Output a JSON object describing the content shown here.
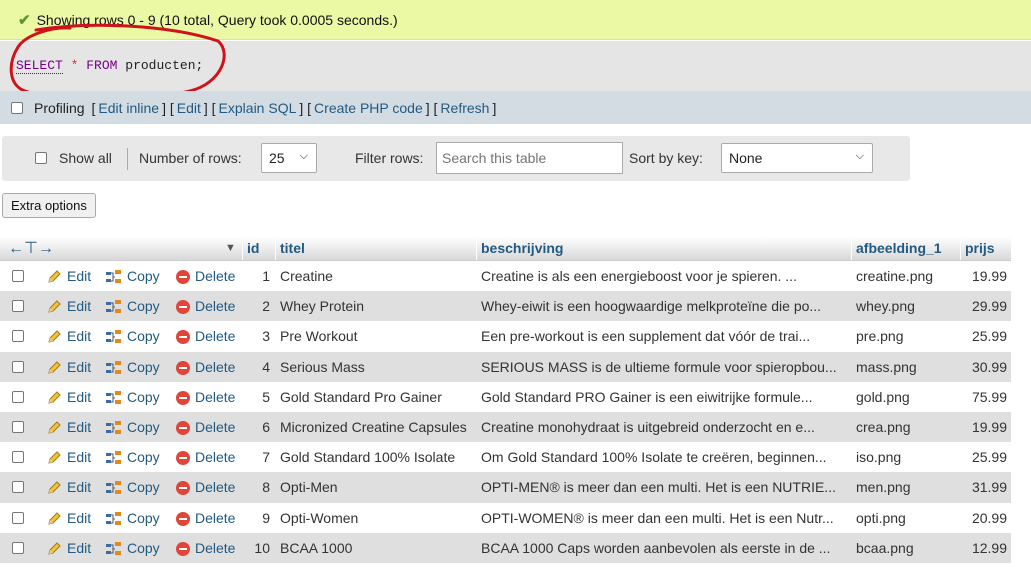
{
  "success": {
    "message": "Showing rows 0 - 9 (10 total, Query took 0.0005 seconds.)"
  },
  "sql": {
    "select": "SELECT",
    "star": "*",
    "from": "FROM",
    "table": "producten;"
  },
  "profiling": {
    "label": "Profiling",
    "links": [
      "Edit inline",
      "Edit",
      "Explain SQL",
      "Create PHP code",
      "Refresh"
    ]
  },
  "nav": {
    "show_all": "Show all",
    "num_rows_label": "Number of rows:",
    "num_rows_value": "25",
    "filter_label": "Filter rows:",
    "filter_placeholder": "Search this table",
    "sort_label": "Sort by key:",
    "sort_value": "None"
  },
  "extra_options": "Extra options",
  "table": {
    "columns": [
      "id",
      "titel",
      "beschrijving",
      "afbeelding_1",
      "prijs"
    ],
    "actions": {
      "edit": "Edit",
      "copy": "Copy",
      "delete": "Delete"
    },
    "rows": [
      {
        "id": "1",
        "titel": "Creatine",
        "beschrijving": "Creatine is als een energieboost voor je spieren. ...",
        "afbeelding": "creatine.png",
        "prijs": "19.99"
      },
      {
        "id": "2",
        "titel": "Whey Protein",
        "beschrijving": "Whey-eiwit is een hoogwaardige melkproteïne die po...",
        "afbeelding": "whey.png",
        "prijs": "29.99"
      },
      {
        "id": "3",
        "titel": "Pre Workout",
        "beschrijving": "Een pre-workout is een supplement dat vóór de trai...",
        "afbeelding": "pre.png",
        "prijs": "25.99"
      },
      {
        "id": "4",
        "titel": "Serious Mass",
        "beschrijving": "SERIOUS MASS is de ultieme formule voor spieropbou...",
        "afbeelding": "mass.png",
        "prijs": "30.99"
      },
      {
        "id": "5",
        "titel": "Gold Standard Pro Gainer",
        "beschrijving": "Gold Standard PRO Gainer is een eiwitrijke formule...",
        "afbeelding": "gold.png",
        "prijs": "75.99"
      },
      {
        "id": "6",
        "titel": "Micronized Creatine Capsules",
        "beschrijving": "Creatine monohydraat is uitgebreid onderzocht en e...",
        "afbeelding": "crea.png",
        "prijs": "19.99"
      },
      {
        "id": "7",
        "titel": "Gold Standard 100% Isolate",
        "beschrijving": "Om Gold Standard 100% Isolate te creëren, beginnen...",
        "afbeelding": "iso.png",
        "prijs": "25.99"
      },
      {
        "id": "8",
        "titel": "Opti-Men",
        "beschrijving": "OPTI-MEN® is meer dan een multi. Het is een NUTRIE...",
        "afbeelding": "men.png",
        "prijs": "31.99"
      },
      {
        "id": "9",
        "titel": "Opti-Women",
        "beschrijving": "OPTI-WOMEN® is meer dan een multi. Het is een Nutr...",
        "afbeelding": "opti.png",
        "prijs": "20.99"
      },
      {
        "id": "10",
        "titel": "BCAA 1000",
        "beschrijving": "BCAA 1000 Caps worden aanbevolen als eerste in de ...",
        "afbeelding": "bcaa.png",
        "prijs": "12.99"
      }
    ]
  },
  "icons": {
    "success": "check-icon",
    "edit": "pencil-icon",
    "copy": "copy-icon",
    "delete": "delete-icon"
  },
  "colors": {
    "link": "#235a81",
    "success_bg": "#ebf8a4",
    "annotation": "#d0121b"
  }
}
